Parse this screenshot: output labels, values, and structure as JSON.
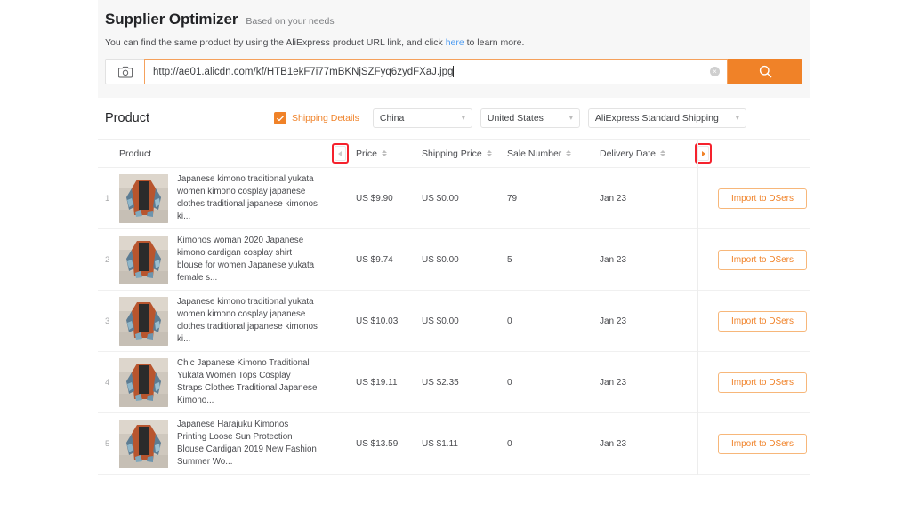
{
  "header": {
    "title": "Supplier Optimizer",
    "subtitle": "Based on your needs",
    "hint_before": "You can find the same product by using the AliExpress product URL link, and click ",
    "hint_link": "here",
    "hint_after": " to learn more."
  },
  "search": {
    "camera_icon": "camera-icon",
    "url_value": "http://ae01.alicdn.com/kf/HTB1ekF7i77mBKNjSZFyq6zydFXaJ.jpg",
    "clear_icon": "×",
    "search_icon": "search-icon",
    "accent_color": "#f08228",
    "border_color": "#f5a15c"
  },
  "filters": {
    "section_title": "Product",
    "shipping_details_label": "Shipping Details",
    "shipping_details_checked": true,
    "ship_from": "China",
    "ship_to": "United States",
    "shipping_method": "AliExpress Standard Shipping"
  },
  "table": {
    "columns": {
      "product": "Product",
      "price": "Price",
      "shipping_price": "Shipping Price",
      "sale_number": "Sale Number",
      "delivery_date": "Delivery Date"
    },
    "scroll_left_icon": "caret-left-icon",
    "scroll_right_icon": "caret-right-icon",
    "highlight_color": "#f5222d",
    "import_label": "Import to DSers",
    "rows": [
      {
        "index": "1",
        "name": "Japanese kimono traditional yukata women kimono cosplay japanese clothes traditional japanese kimonos ki...",
        "price": "US $9.90",
        "shipping_price": "US $0.00",
        "sale_number": "79",
        "delivery_date": "Jan 23"
      },
      {
        "index": "2",
        "name": "Kimonos woman 2020 Japanese kimono cardigan cosplay shirt blouse for women Japanese yukata female s...",
        "price": "US $9.74",
        "shipping_price": "US $0.00",
        "sale_number": "5",
        "delivery_date": "Jan 23"
      },
      {
        "index": "3",
        "name": "Japanese kimono traditional yukata women kimono cosplay japanese clothes traditional japanese kimonos ki...",
        "price": "US $10.03",
        "shipping_price": "US $0.00",
        "sale_number": "0",
        "delivery_date": "Jan 23"
      },
      {
        "index": "4",
        "name": "Chic Japanese Kimono Traditional Yukata Women Tops Cosplay Straps Clothes Traditional Japanese Kimono...",
        "price": "US $19.11",
        "shipping_price": "US $2.35",
        "sale_number": "0",
        "delivery_date": "Jan 23"
      },
      {
        "index": "5",
        "name": "Japanese Harajuku Kimonos Printing Loose Sun Protection Blouse Cardigan 2019 New Fashion Summer Wo...",
        "price": "US $13.59",
        "shipping_price": "US $1.11",
        "sale_number": "0",
        "delivery_date": "Jan 23"
      }
    ]
  }
}
